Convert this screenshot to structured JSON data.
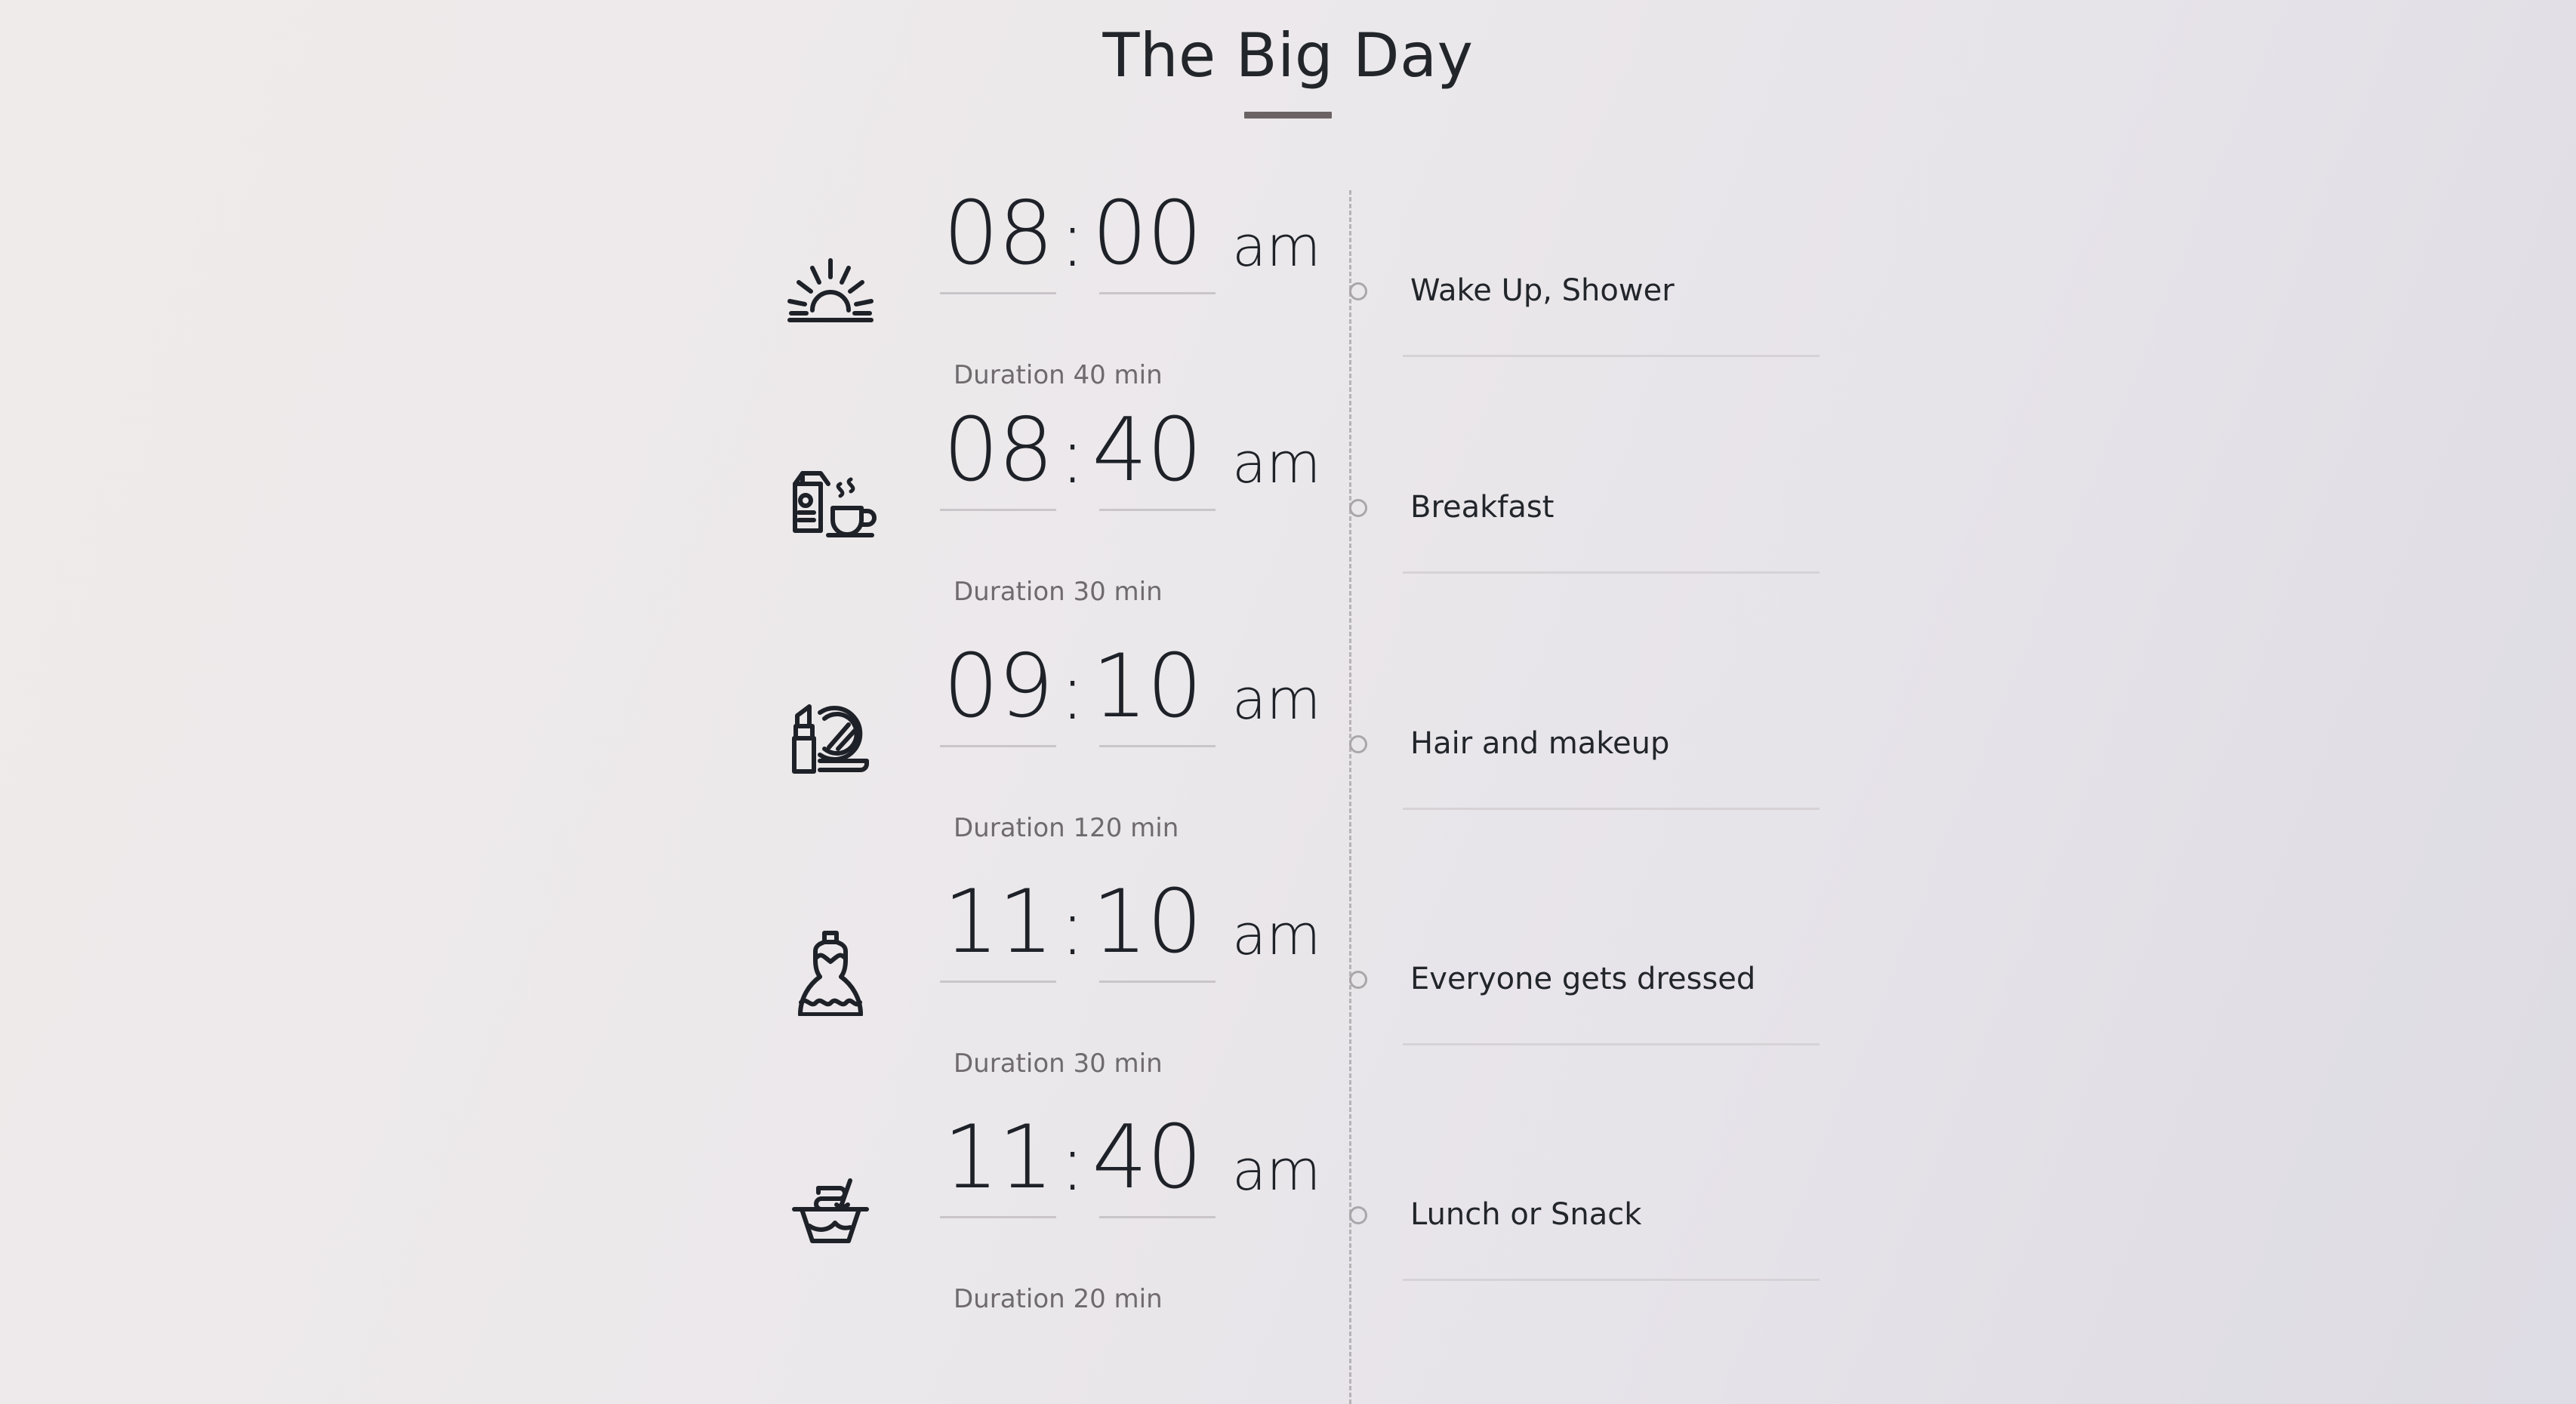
{
  "header": {
    "title": "The Big Day"
  },
  "timeline": {
    "events": [
      {
        "icon": "sunrise-icon",
        "hour": "08",
        "separator": ":",
        "minute": "00",
        "meridiem": "am",
        "duration": "Duration 40 min",
        "label": "Wake Up, Shower"
      },
      {
        "icon": "breakfast-icon",
        "hour": "08",
        "separator": ":",
        "minute": "40",
        "meridiem": "am",
        "duration": "Duration 30 min",
        "label": "Breakfast"
      },
      {
        "icon": "makeup-icon",
        "hour": "09",
        "separator": ":",
        "minute": "10",
        "meridiem": "am",
        "duration": "Duration 120 min",
        "label": "Hair and makeup"
      },
      {
        "icon": "dress-icon",
        "hour": "11",
        "separator": ":",
        "minute": "10",
        "meridiem": "am",
        "duration": "Duration 30 min",
        "label": "Everyone gets dressed"
      },
      {
        "icon": "takeout-bowl-icon",
        "hour": "11",
        "separator": ":",
        "minute": "40",
        "meridiem": "am",
        "duration": "Duration 20 min",
        "label": "Lunch or Snack"
      }
    ]
  },
  "colors": {
    "text_primary": "#22262b",
    "text_muted": "#6f6a6d",
    "rule": "#c9c5c9",
    "accent_bar": "#6b6264",
    "spine": "#b6b2b6",
    "background_warm": "#efebea",
    "background_cool": "#dedce4"
  }
}
